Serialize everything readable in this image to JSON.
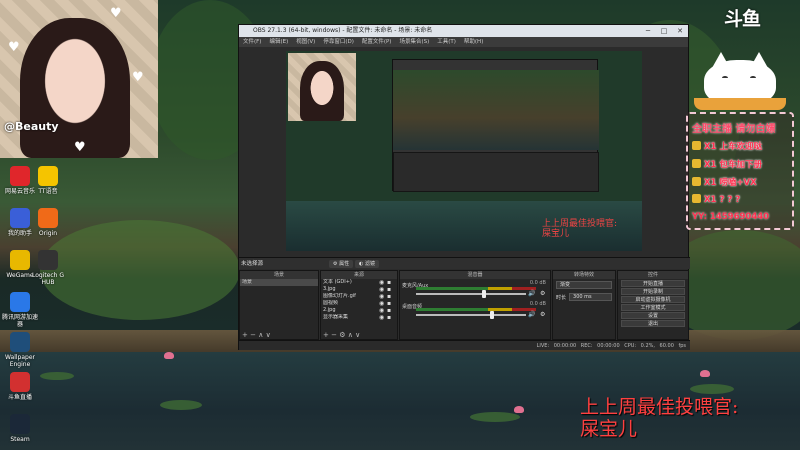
{
  "webcam": {
    "tag": "@Beauty"
  },
  "desktop_icons": [
    {
      "label": "网易云音乐",
      "color": "#e0262b"
    },
    {
      "label": "TT语音",
      "color": "#f5c400"
    },
    {
      "label": "我的助手",
      "color": "#3a5fd8"
    },
    {
      "label": "Origin",
      "color": "#f06a18"
    },
    {
      "label": "WeGame",
      "color": "#e8b800"
    },
    {
      "label": "Logitech G HUB",
      "color": "#333333"
    },
    {
      "label": "腾讯网游加速器",
      "color": "#2a78e8"
    },
    {
      "label": "Wallpaper Engine",
      "color": "#1f4e7a"
    },
    {
      "label": "斗鱼直播",
      "color": "#d23030"
    },
    {
      "label": "Steam",
      "color": "#1b2838"
    }
  ],
  "obs": {
    "title": "OBS 27.1.3 (64-bit, windows) - 配置文件: 未命名 - 场景: 未命名",
    "menu": [
      "文件(F)",
      "编辑(E)",
      "视图(V)",
      "停靠窗口(D)",
      "配置文件(P)",
      "场景集合(S)",
      "工具(T)",
      "帮助(H)"
    ],
    "preview_caption": [
      "上上周最佳投喂官:",
      "屎宝儿"
    ],
    "source_bar": {
      "label": "未选择源",
      "props": "属性",
      "filters": "滤镜"
    },
    "docks": {
      "scenes": {
        "title": "场景",
        "items": [
          "场景"
        ]
      },
      "sources": {
        "title": "来源",
        "items": [
          "文本 (GDI+)",
          "3.jpg",
          "图像幻灯片.gif",
          "圆视频",
          "2.jpg",
          "显示器采集"
        ]
      },
      "mixer": {
        "title": "混音器",
        "channels": [
          {
            "name": "麦克风/Aux",
            "db": "0.0 dB",
            "level": 0.62
          },
          {
            "name": "桌面音频",
            "db": "0.0 dB",
            "level": 0.7
          }
        ]
      },
      "transitions": {
        "title": "转场特效",
        "type": "渐变",
        "duration_label": "时长",
        "duration": "300 ms"
      },
      "controls": {
        "title": "控件",
        "buttons": [
          "开始直播",
          "开始录制",
          "启动虚拟摄像机",
          "工作室模式",
          "设置",
          "退出"
        ]
      }
    },
    "status": [
      "LIVE: 00:00:00",
      "REC: 00:00:00",
      "CPU: 0.2%, 60.00 fps"
    ]
  },
  "overlay": {
    "logo": "斗鱼",
    "title": "全职主播 请勿白嫖",
    "entries": [
      {
        "count": "X1",
        "text": "上车欢迎哒"
      },
      {
        "count": "X1",
        "text": "包车加下册"
      },
      {
        "count": "X1",
        "text": "唠嗑+VX"
      },
      {
        "count": "X1",
        "text": "? ? ?"
      }
    ],
    "yy": "YY: 1459690440"
  },
  "caption": [
    "上上周最佳投喂官:",
    "屎宝儿"
  ]
}
